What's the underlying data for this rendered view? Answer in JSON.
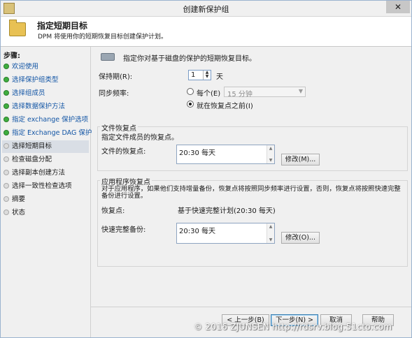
{
  "window": {
    "title": "创建新保护组",
    "close_glyph": "✕"
  },
  "header": {
    "heading": "指定短期目标",
    "subheading": "DPM 将使用你的短期恢复目标创建保护计划。"
  },
  "sidebar": {
    "steps_label": "步骤:",
    "items": [
      {
        "label": "欢迎使用",
        "state": "done"
      },
      {
        "label": "选择保护组类型",
        "state": "done"
      },
      {
        "label": "选择组成员",
        "state": "done"
      },
      {
        "label": "选择数据保护方法",
        "state": "done"
      },
      {
        "label": "指定 exchange 保护选项",
        "state": "done"
      },
      {
        "label": "指定 Exchange DAG 保护",
        "state": "done"
      },
      {
        "label": "选择短期目标",
        "state": "current"
      },
      {
        "label": "检查磁盘分配",
        "state": "pending"
      },
      {
        "label": "选择副本创建方法",
        "state": "pending"
      },
      {
        "label": "选择一致性检查选项",
        "state": "pending"
      },
      {
        "label": "摘要",
        "state": "pending"
      },
      {
        "label": "状态",
        "state": "pending"
      }
    ]
  },
  "main": {
    "intro": "指定你对基于磁盘的保护的短期恢复目标。",
    "retention": {
      "label": "保持期(R):",
      "value": "1",
      "unit": "天"
    },
    "sync": {
      "label": "同步频率:",
      "option_every": "每个(E)",
      "every_select": "15 分钟",
      "option_before": "就在恢复点之前(I)"
    },
    "file_recovery": {
      "title": "文件恢复点",
      "desc": "指定文件成员的恢复点。",
      "label": "文件的恢复点:",
      "value": "20:30 每天",
      "modify": "修改(M)..."
    },
    "app_recovery": {
      "title": "应用程序恢复点",
      "desc": "对于应用程序，如果他们支持增量备份，恢复点将按照同步频率进行设置，否则，恢复点将按照快速完整备份进行设置。",
      "rp_label": "恢复点:",
      "rp_value": "基于快速完整计划(20:30 每天)",
      "express_label": "快速完整备份:",
      "express_value": "20:30 每天",
      "modify": "修改(O)..."
    }
  },
  "footer": {
    "back": "< 上一步(B)",
    "next": "下一步(N) >",
    "cancel": "取消",
    "help": "帮助"
  },
  "watermark": "© 2016 ZJUNSEN http://rdsrv.blog.51cto.com"
}
